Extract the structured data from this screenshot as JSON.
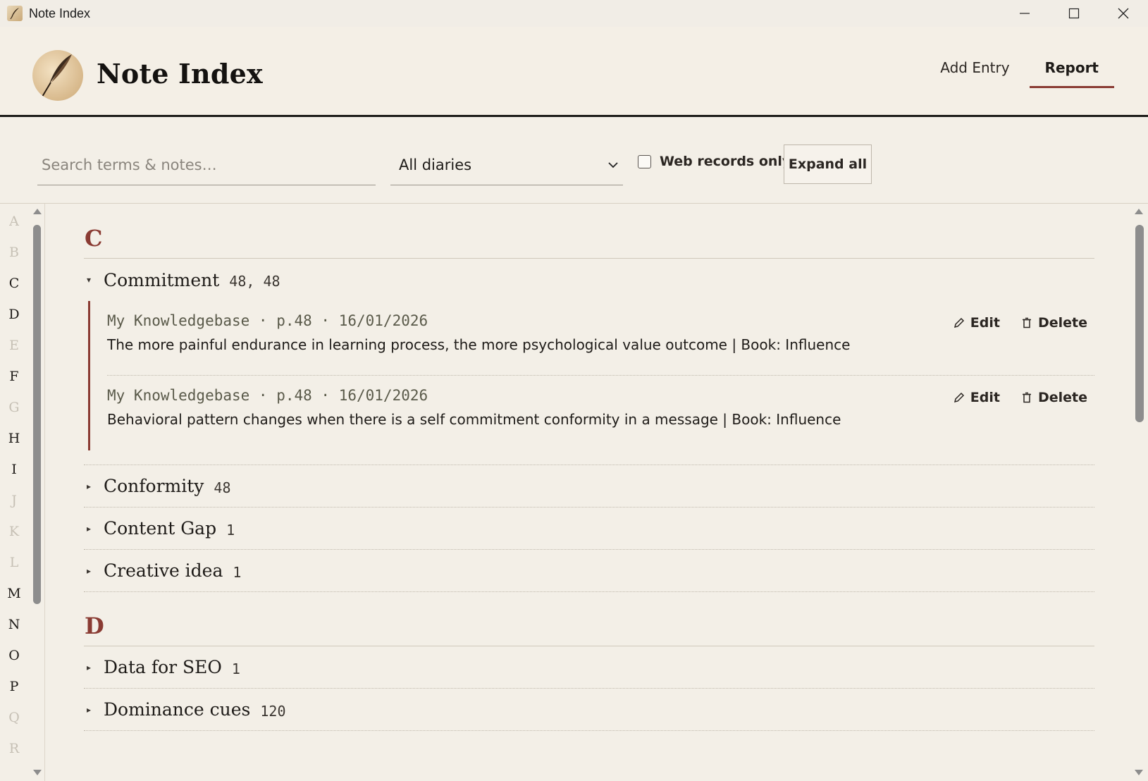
{
  "window": {
    "title": "Note Index"
  },
  "header": {
    "brand": "Note Index",
    "nav": [
      {
        "label": "Add Entry",
        "active": false
      },
      {
        "label": "Report",
        "active": true
      }
    ]
  },
  "toolbar": {
    "search_placeholder": "Search terms & notes…",
    "diary_select": "All diaries",
    "web_only_label": "Web records only",
    "web_only_checked": false,
    "expand_label": "Expand all"
  },
  "alphabet": [
    {
      "letter": "A",
      "active": false
    },
    {
      "letter": "B",
      "active": false
    },
    {
      "letter": "C",
      "active": true
    },
    {
      "letter": "D",
      "active": true
    },
    {
      "letter": "E",
      "active": false
    },
    {
      "letter": "F",
      "active": true
    },
    {
      "letter": "G",
      "active": false
    },
    {
      "letter": "H",
      "active": true
    },
    {
      "letter": "I",
      "active": true
    },
    {
      "letter": "J",
      "active": false
    },
    {
      "letter": "K",
      "active": false
    },
    {
      "letter": "L",
      "active": false
    },
    {
      "letter": "M",
      "active": true
    },
    {
      "letter": "N",
      "active": true
    },
    {
      "letter": "O",
      "active": true
    },
    {
      "letter": "P",
      "active": true
    },
    {
      "letter": "Q",
      "active": false
    },
    {
      "letter": "R",
      "active": false
    }
  ],
  "sections": [
    {
      "letter": "C",
      "terms": [
        {
          "name": "Commitment",
          "pages": "48, 48",
          "expanded": true,
          "entries": [
            {
              "meta": "My Knowledgebase · p.48 · 16/01/2026",
              "note": "The more painful endurance in learning process, the more psychological value outcome | Book: Influence",
              "edit": "Edit",
              "delete": "Delete"
            },
            {
              "meta": "My Knowledgebase · p.48 · 16/01/2026",
              "note": "Behavioral pattern changes when there is a self commitment conformity in a message | Book: Influence",
              "edit": "Edit",
              "delete": "Delete"
            }
          ]
        },
        {
          "name": "Conformity",
          "pages": "48",
          "expanded": false
        },
        {
          "name": "Content Gap",
          "pages": "1",
          "expanded": false
        },
        {
          "name": "Creative idea",
          "pages": "1",
          "expanded": false
        }
      ]
    },
    {
      "letter": "D",
      "terms": [
        {
          "name": "Data for SEO",
          "pages": "1",
          "expanded": false
        },
        {
          "name": "Dominance cues",
          "pages": "120",
          "expanded": false
        }
      ]
    }
  ]
}
